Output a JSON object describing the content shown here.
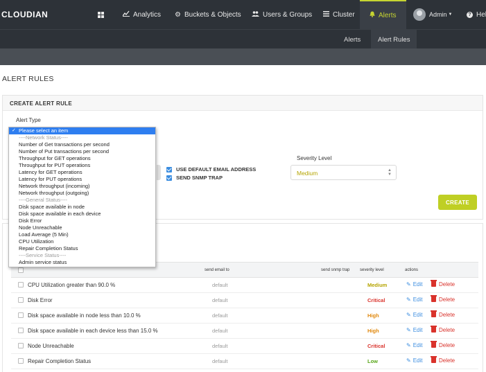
{
  "brand": {
    "logo": "CLOUDIAN"
  },
  "nav": {
    "items": [
      {
        "label": "Analytics",
        "icon": "chart-line-icon"
      },
      {
        "label": "Buckets & Objects",
        "icon": "gear-icon"
      },
      {
        "label": "Users & Groups",
        "icon": "users-icon"
      },
      {
        "label": "Cluster",
        "icon": "list-icon"
      },
      {
        "label": "Alerts",
        "icon": "bell-icon",
        "active": true
      },
      {
        "label": "Admin",
        "icon": "avatar"
      },
      {
        "label": "Help",
        "icon": "help-icon"
      }
    ],
    "home_icon": "dashboard-grid-icon"
  },
  "subnav": {
    "items": [
      "Alerts",
      "Alert Rules"
    ]
  },
  "page": {
    "title": "ALERT RULES"
  },
  "create_panel": {
    "title": "CREATE ALERT RULE",
    "alert_type_label": "Alert Type",
    "use_default_email": "USE DEFAULT EMAIL ADDRESS",
    "send_snmp_trap": "SEND SNMP TRAP",
    "severity_label": "Severity Level",
    "severity_value": "Medium",
    "create_button": "CREATE"
  },
  "dropdown": {
    "options": [
      {
        "label": "Please select an item",
        "type": "selected"
      },
      {
        "label": "----Network Status----",
        "type": "group"
      },
      {
        "label": "Number of Get transactions per second",
        "type": "option"
      },
      {
        "label": "Number of Put transactions per second",
        "type": "option"
      },
      {
        "label": "Throughput for GET operations",
        "type": "option"
      },
      {
        "label": "Throughput for PUT operations",
        "type": "option"
      },
      {
        "label": "Latency for GET operations",
        "type": "option"
      },
      {
        "label": "Latency for PUT operations",
        "type": "option"
      },
      {
        "label": "Network throughput (incoming)",
        "type": "option"
      },
      {
        "label": "Network throughput (outgoing)",
        "type": "option"
      },
      {
        "label": "----General Status----",
        "type": "group"
      },
      {
        "label": "Disk space available in node",
        "type": "option"
      },
      {
        "label": "Disk space available in each device",
        "type": "option"
      },
      {
        "label": "Disk Error",
        "type": "option"
      },
      {
        "label": "Node Unreachable",
        "type": "option"
      },
      {
        "label": "Load Average (5 Min)",
        "type": "option"
      },
      {
        "label": "CPU Utilization",
        "type": "option"
      },
      {
        "label": "Repair Completion Status",
        "type": "option"
      },
      {
        "label": "----Service Status----",
        "type": "group"
      },
      {
        "label": "Admin service status",
        "type": "option"
      }
    ]
  },
  "rules_table": {
    "headers": {
      "send_email": "send email to",
      "send_snmp": "send snmp trap",
      "severity": "severity level",
      "actions": "actions"
    },
    "edit_label": "Edit",
    "delete_label": "Delete",
    "rows": [
      {
        "name": "CPU Utilization greater than 90.0 %",
        "email": "default",
        "severity": "Medium"
      },
      {
        "name": "Disk Error",
        "email": "default",
        "severity": "Critical"
      },
      {
        "name": "Disk space available in node less than 10.0 %",
        "email": "default",
        "severity": "High"
      },
      {
        "name": "Disk space available in each device less than 15.0 %",
        "email": "default",
        "severity": "High"
      },
      {
        "name": "Node Unreachable",
        "email": "default",
        "severity": "Critical"
      },
      {
        "name": "Repair Completion Status",
        "email": "default",
        "severity": "Low"
      }
    ]
  },
  "colors": {
    "accent": "#c6d431",
    "create_button": "#bfcf24",
    "link": "#3b8de0",
    "delete": "#d9322b",
    "severity_medium": "#b5a400",
    "severity_critical": "#d9322b",
    "severity_high": "#e0870b",
    "severity_low": "#58a619"
  }
}
